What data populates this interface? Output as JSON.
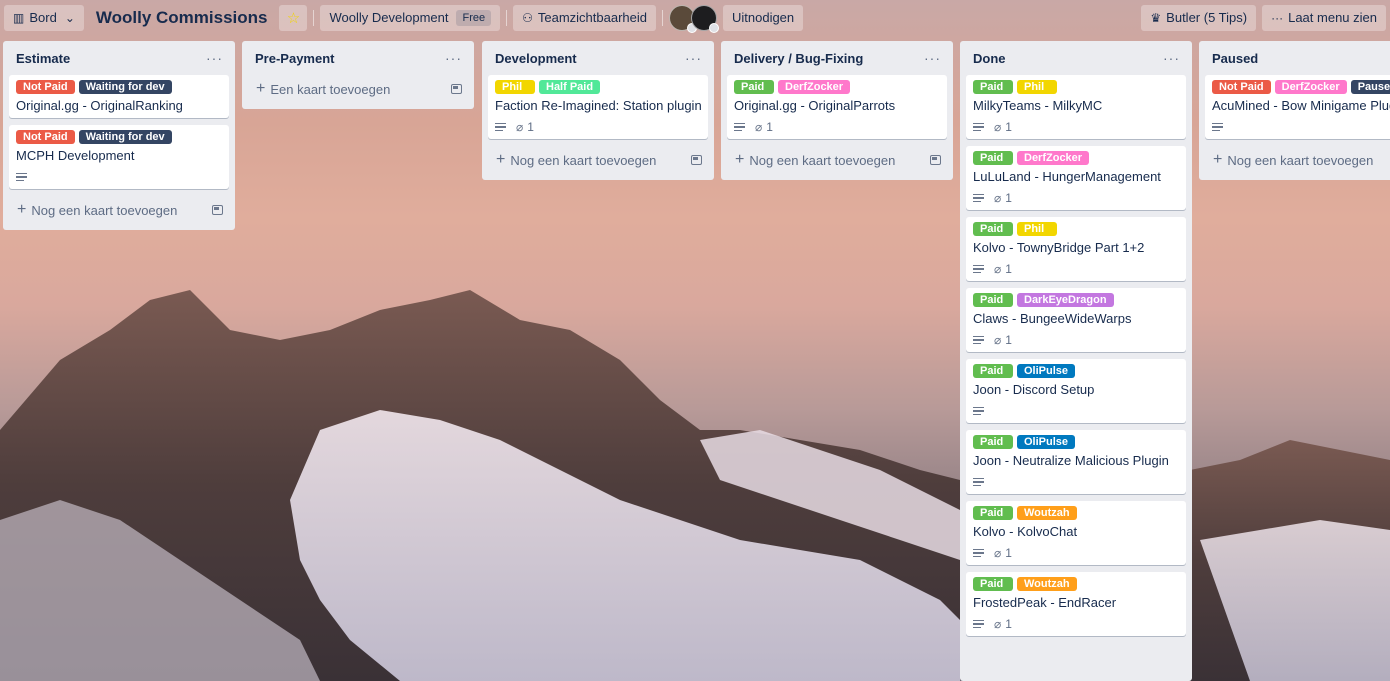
{
  "header": {
    "board_view_label": "Bord",
    "board_title": "Woolly Commissions",
    "workspace_name": "Woolly Development",
    "workspace_plan": "Free",
    "visibility_label": "Teamzichtbaarheid",
    "invite_label": "Uitnodigen",
    "butler_label": "Butler (5 Tips)",
    "menu_label": "Laat menu zien"
  },
  "labels": {
    "not_paid": {
      "text": "Not Paid",
      "color": "#eb5a46"
    },
    "waiting": {
      "text": "Waiting for dev",
      "color": "#344563"
    },
    "phil": {
      "text": "Phil",
      "color": "#f2d600"
    },
    "half_paid": {
      "text": "Half Paid",
      "color": "#51e898"
    },
    "paid": {
      "text": "Paid",
      "color": "#61bd4f"
    },
    "derfzocker": {
      "text": "DerfZocker",
      "color": "#ff78cb"
    },
    "darkeyedragon": {
      "text": "DarkEyeDragon",
      "color": "#c377e0"
    },
    "olipulse": {
      "text": "OliPulse",
      "color": "#0079bf"
    },
    "woutzah": {
      "text": "Woutzah",
      "color": "#ff9f1a"
    },
    "paused": {
      "text": "Paused",
      "color": "#344563"
    }
  },
  "lists": [
    {
      "title": "Estimate",
      "add_label": "Nog een kaart toevoegen",
      "cards": [
        {
          "labels": [
            "not_paid",
            "waiting"
          ],
          "title": "Original.gg - OriginalRanking",
          "description": false,
          "attachments": null
        },
        {
          "labels": [
            "not_paid",
            "waiting"
          ],
          "title": "MCPH Development",
          "description": true,
          "attachments": null
        }
      ]
    },
    {
      "title": "Pre-Payment",
      "add_label": "Een kaart toevoegen",
      "cards": []
    },
    {
      "title": "Development",
      "add_label": "Nog een kaart toevoegen",
      "cards": [
        {
          "labels": [
            "phil",
            "half_paid"
          ],
          "title": "Faction Re-Imagined: Station plugin",
          "description": true,
          "attachments": "1"
        }
      ]
    },
    {
      "title": "Delivery / Bug-Fixing",
      "add_label": "Nog een kaart toevoegen",
      "cards": [
        {
          "labels": [
            "paid",
            "derfzocker"
          ],
          "title": "Original.gg - OriginalParrots",
          "description": true,
          "attachments": "1"
        }
      ]
    },
    {
      "title": "Done",
      "add_label": "",
      "cards": [
        {
          "labels": [
            "paid",
            "phil"
          ],
          "title": "MilkyTeams - MilkyMC",
          "description": true,
          "attachments": "1"
        },
        {
          "labels": [
            "paid",
            "derfzocker"
          ],
          "title": "LuLuLand - HungerManagement",
          "description": true,
          "attachments": "1"
        },
        {
          "labels": [
            "paid",
            "phil"
          ],
          "title": "Kolvo - TownyBridge Part 1+2",
          "description": true,
          "attachments": "1"
        },
        {
          "labels": [
            "paid",
            "darkeyedragon"
          ],
          "title": "Claws - BungeeWideWarps",
          "description": true,
          "attachments": "1"
        },
        {
          "labels": [
            "paid",
            "olipulse"
          ],
          "title": "Joon - Discord Setup",
          "description": true,
          "attachments": null
        },
        {
          "labels": [
            "paid",
            "olipulse"
          ],
          "title": "Joon - Neutralize Malicious Plugin",
          "description": true,
          "attachments": null
        },
        {
          "labels": [
            "paid",
            "woutzah"
          ],
          "title": "Kolvo - KolvoChat",
          "description": true,
          "attachments": "1"
        },
        {
          "labels": [
            "paid",
            "woutzah"
          ],
          "title": "FrostedPeak - EndRacer",
          "description": true,
          "attachments": "1"
        }
      ]
    },
    {
      "title": "Paused",
      "add_label": "Nog een kaart toevoegen",
      "cards": [
        {
          "labels": [
            "not_paid",
            "derfzocker",
            "paused"
          ],
          "title": "AcuMined - Bow Minigame Plugin",
          "description": true,
          "attachments": null
        }
      ]
    }
  ]
}
